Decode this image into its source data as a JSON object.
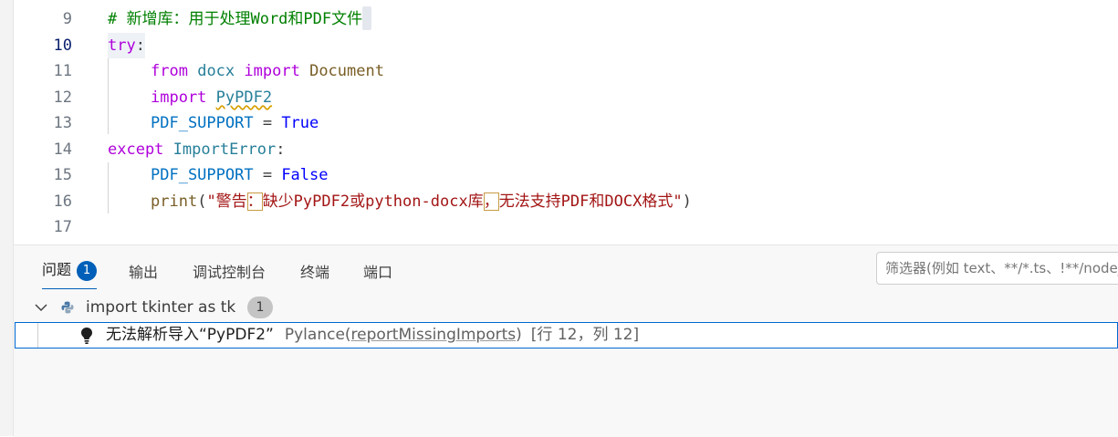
{
  "editor": {
    "lines": [
      {
        "num": "9",
        "comment": "# 新增库：用于处理Word和PDF文件"
      },
      {
        "num": "10",
        "kw": "try",
        "punct": ":"
      },
      {
        "num": "11",
        "kw1": "from",
        "module": "docx",
        "kw2": "import",
        "name": "Document"
      },
      {
        "num": "12",
        "kw": "import",
        "module": "PyPDF2"
      },
      {
        "num": "13",
        "var": "PDF_SUPPORT",
        "op": " = ",
        "val": "True"
      },
      {
        "num": "14",
        "kw": "except",
        "cls": "ImportError",
        "punct": ":"
      },
      {
        "num": "15",
        "var": "PDF_SUPPORT",
        "op": " = ",
        "val": "False"
      },
      {
        "num": "16",
        "fn": "print",
        "open": "(",
        "s1": "\"警告",
        "m1": "：",
        "s2": "缺少PyPDF2或python-docx库",
        "m2": "，",
        "s3": "无法支持PDF和DOCX格式\"",
        "close": ")"
      },
      {
        "num": "17"
      }
    ]
  },
  "panel": {
    "tabs": [
      {
        "label": "问题",
        "badge": "1"
      },
      {
        "label": "输出"
      },
      {
        "label": "调试控制台"
      },
      {
        "label": "终端"
      },
      {
        "label": "端口"
      }
    ],
    "filter_placeholder": "筛选器(例如 text、**/*.ts、!**/node_modules/**)",
    "group": {
      "file": "import tkinter as tk",
      "count": "1"
    },
    "problem": {
      "message": "无法解析导入“PyPDF2”",
      "source": "Pylance(",
      "code": "reportMissingImports",
      "source_close": ")",
      "location": "[行 12，列 12]"
    }
  },
  "colors": {
    "accent": "#005fb8",
    "keyword": "#af00db",
    "comment": "#008000",
    "string": "#a31515"
  }
}
